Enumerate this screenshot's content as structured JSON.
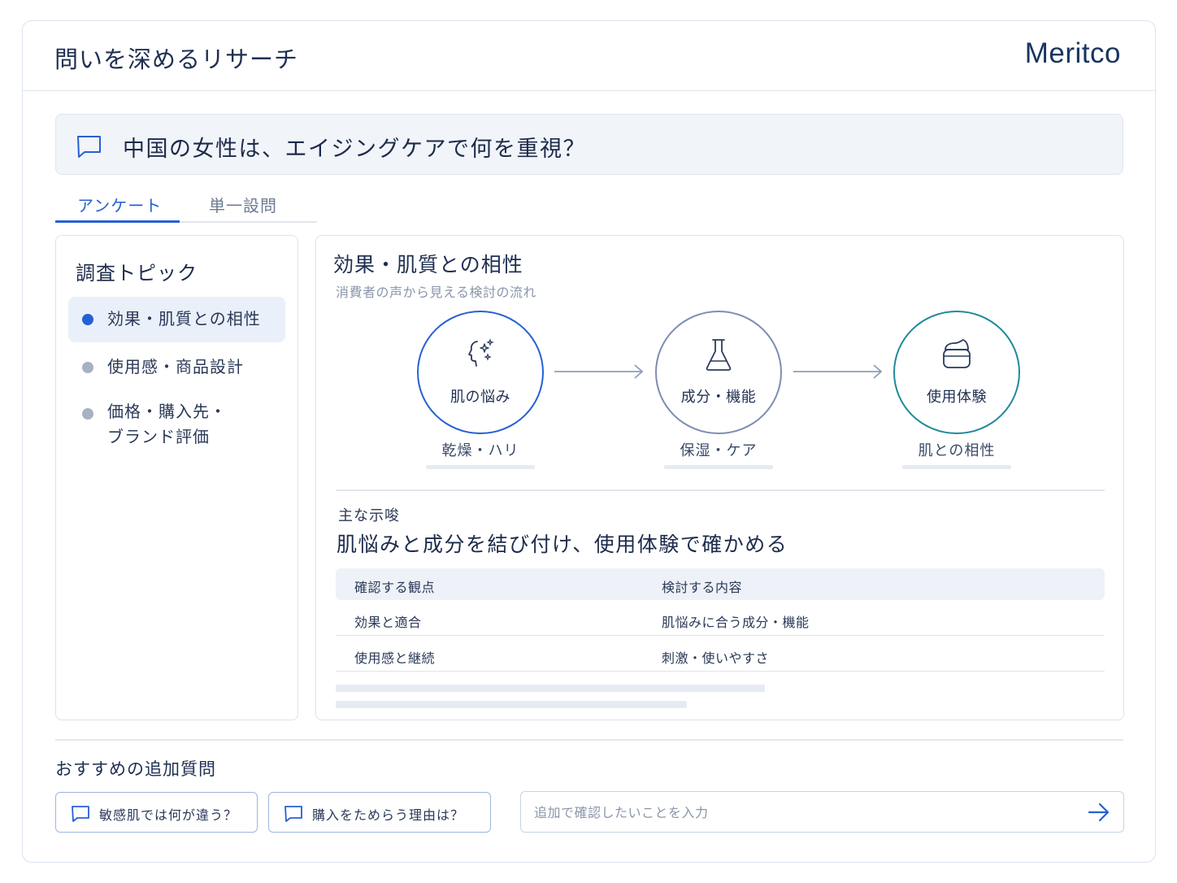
{
  "header": {
    "title": "問いを深めるリサーチ",
    "brand": "Meritco"
  },
  "question": {
    "icon": "chat-bubble-icon",
    "text": "中国の女性は、エイジングケアで何を重視？"
  },
  "tabs": [
    {
      "label": "アンケート",
      "active": true
    },
    {
      "label": "単一設問",
      "active": false
    }
  ],
  "sidebar": {
    "title": "調査トピック",
    "items": [
      {
        "label": "効果・肌質との相性",
        "active": true
      },
      {
        "label": "使用感・商品設計",
        "active": false
      },
      {
        "label": "価格・購入先・",
        "label2": "ブランド評価",
        "active": false
      }
    ]
  },
  "main": {
    "title": "効果・肌質との相性",
    "subtitle": "消費者の声から見える検討の流れ",
    "flow": [
      {
        "label": "肌の悩み",
        "sub": "乾燥・ハリ",
        "icon": "face-sparkle-icon",
        "color": "#2760d4"
      },
      {
        "label": "成分・機能",
        "sub": "保湿・ケア",
        "icon": "flask-icon",
        "color": "#7e8db3"
      },
      {
        "label": "使用体験",
        "sub": "肌との相性",
        "icon": "cream-jar-icon",
        "color": "#1f8a9a"
      }
    ],
    "insight_label": "主な示唆",
    "insight": "肌悩みと成分を結び付け、使用体験で確かめる",
    "table": {
      "headers": [
        "確認する観点",
        "検討する内容"
      ],
      "rows": [
        [
          "効果と適合",
          "肌悩みに合う成分・機能"
        ],
        [
          "使用感と継続",
          "刺激・使いやすさ"
        ]
      ]
    }
  },
  "suggestions": {
    "title": "おすすめの追加質問",
    "chips": [
      "敏感肌では何が違う？",
      "購入をためらう理由は？"
    ],
    "input_placeholder": "追加で確認したいことを入力",
    "send_icon": "arrow-right-icon"
  },
  "colors": {
    "accent": "#2760d4",
    "text": "#1c2b4a",
    "border": "#dbe3ee",
    "teal": "#1f8a9a"
  }
}
